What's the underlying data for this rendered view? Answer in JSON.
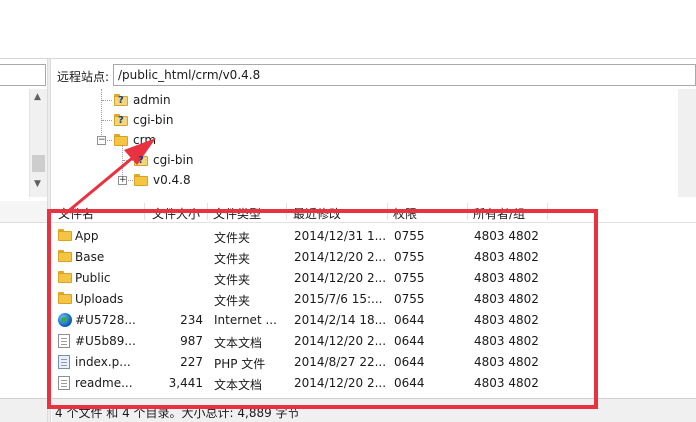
{
  "remote_site": {
    "label": "远程站点:",
    "path": "/public_html/crm/v0.4.8"
  },
  "tree": [
    {
      "label": "admin",
      "icon": "folder-question-icon"
    },
    {
      "label": "cgi-bin",
      "icon": "folder-question-icon"
    },
    {
      "label": "crm",
      "icon": "folder-icon",
      "expander": "−"
    },
    {
      "label": "cgi-bin",
      "icon": "folder-question-icon"
    },
    {
      "label": "v0.4.8",
      "icon": "folder-icon",
      "expander": "+"
    }
  ],
  "columns": [
    "文件名",
    "文件大小",
    "文件类型",
    "最近修改",
    "权限",
    "所有者/组"
  ],
  "files": [
    {
      "name": "App",
      "size": "",
      "type": "文件夹",
      "modified": "2014/12/31 1...",
      "perm": "0755",
      "owner": "4803 4802",
      "icon": "folder-icon"
    },
    {
      "name": "Base",
      "size": "",
      "type": "文件夹",
      "modified": "2014/12/20 2...",
      "perm": "0755",
      "owner": "4803 4802",
      "icon": "folder-icon"
    },
    {
      "name": "Public",
      "size": "",
      "type": "文件夹",
      "modified": "2014/12/20 2...",
      "perm": "0755",
      "owner": "4803 4802",
      "icon": "folder-icon"
    },
    {
      "name": "Uploads",
      "size": "",
      "type": "文件夹",
      "modified": "2015/7/6 15:...",
      "perm": "0755",
      "owner": "4803 4802",
      "icon": "folder-icon"
    },
    {
      "name": "#U5728...",
      "size": "234",
      "type": "Internet ...",
      "modified": "2014/2/14 18...",
      "perm": "0644",
      "owner": "4803 4802",
      "icon": "globe-icon"
    },
    {
      "name": "#U5b89...",
      "size": "987",
      "type": "文本文档",
      "modified": "2014/12/20 2...",
      "perm": "0644",
      "owner": "4803 4802",
      "icon": "text-file-icon"
    },
    {
      "name": "index.p...",
      "size": "227",
      "type": "PHP 文件",
      "modified": "2014/8/27 22...",
      "perm": "0644",
      "owner": "4803 4802",
      "icon": "php-file-icon"
    },
    {
      "name": "readme...",
      "size": "3,441",
      "type": "文本文档",
      "modified": "2014/12/20 2...",
      "perm": "0644",
      "owner": "4803 4802",
      "icon": "text-file-icon"
    }
  ],
  "status": "4 个文件 和 4 个目录。大小总计: 4,889 字节",
  "colors": {
    "annotation": "#e8323f",
    "folder": "#f4c542"
  }
}
